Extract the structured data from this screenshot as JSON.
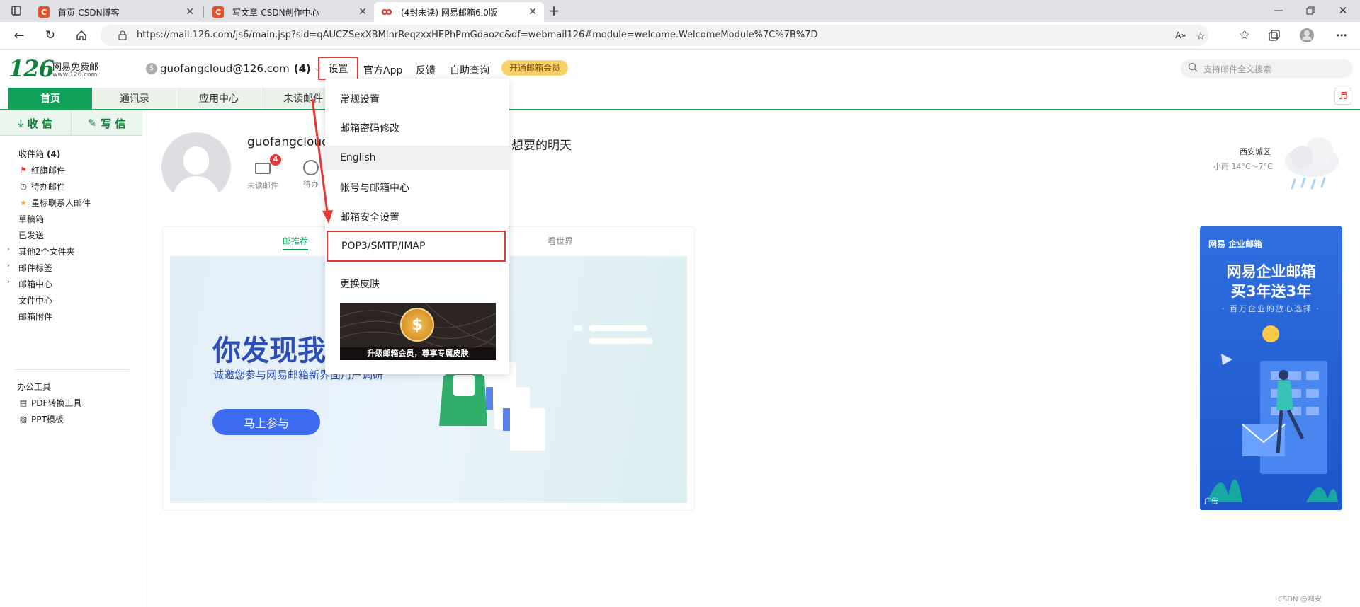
{
  "browser": {
    "tabs": [
      {
        "title": "首页-CSDN博客",
        "favicon": "C",
        "active": false
      },
      {
        "title": "写文章-CSDN创作中心",
        "favicon": "C",
        "active": false
      },
      {
        "title": "(4封未读) 网易邮箱6.0版",
        "favicon": "126",
        "active": true
      }
    ],
    "url": "https://mail.126.com/js6/main.jsp?sid=qAUCZSexXBMInrReqzxxHEPhPmGdaozc&df=webmail126#module=welcome.WelcomeModule%7C%7B%7D"
  },
  "header": {
    "logo_number": "126",
    "logo_text": "网易免费邮",
    "logo_url": "www.126.com",
    "account": "guofangcloud@126.com",
    "account_unread": "(4)",
    "settings": "设置",
    "official_app": "官方App",
    "feedback": "反馈",
    "self_service": "自助查询",
    "vip": "开通邮箱会员",
    "search_placeholder": "支持邮件全文搜索"
  },
  "module_tabs": [
    "首页",
    "通讯录",
    "应用中心",
    "未读邮件"
  ],
  "sidebar": {
    "receive": "收 信",
    "write": "写 信",
    "folders": [
      {
        "label": "收件箱",
        "count": "(4)"
      },
      {
        "label": "红旗邮件"
      },
      {
        "label": "待办邮件"
      },
      {
        "label": "星标联系人邮件"
      },
      {
        "label": "草稿箱"
      },
      {
        "label": "已发送"
      },
      {
        "label": "其他2个文件夹"
      },
      {
        "label": "邮件标签"
      },
      {
        "label": "邮箱中心"
      },
      {
        "label": "文件中心"
      },
      {
        "label": "邮箱附件"
      }
    ],
    "tools_title": "办公工具",
    "tools": [
      "PDF转换工具",
      "PPT模板"
    ]
  },
  "welcome": {
    "greeting_name": "guofangcloud,",
    "greeting_rest": "想要的明天",
    "unread_label": "未读邮件",
    "unread_count": "4",
    "todo_label": "待办"
  },
  "weather": {
    "city": "西安城区",
    "desc": "小雨 14°C～7°C"
  },
  "content_tabs": {
    "recommend": "邮推荐",
    "world": "看世界"
  },
  "banner": {
    "title": "你发现我还",
    "subtitle": "诚邀您参与网易邮箱新界面用户调研",
    "cta": "马上参与"
  },
  "ad": {
    "brand": "网易 企业邮箱",
    "line1": "网易企业邮箱",
    "line2": "买3年送3年",
    "line3": "· 百万企业的放心选择 ·",
    "tag": "广告"
  },
  "menu": {
    "items": [
      "常规设置",
      "邮箱密码修改",
      "English",
      "帐号与邮箱中心",
      "邮箱安全设置",
      "POP3/SMTP/IMAP",
      "更换皮肤"
    ],
    "skin_caption": "升级邮箱会员，尊享专属皮肤"
  },
  "watermark": "CSDN @啁安",
  "colors": {
    "brand_green": "#11a05a",
    "highlight_red": "#e53935",
    "cta_blue": "#3d6bf0"
  }
}
